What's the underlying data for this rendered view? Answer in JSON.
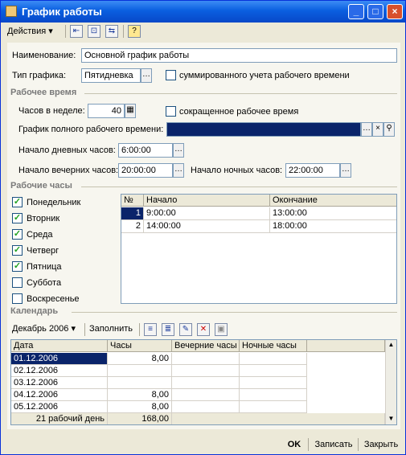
{
  "window": {
    "title": "График работы",
    "min": "_",
    "max": "□",
    "close": "×"
  },
  "toolbar": {
    "actions": "Действия",
    "help": "?"
  },
  "general": {
    "name_label": "Наименование:",
    "name_value": "Основной график работы",
    "type_label": "Тип графика:",
    "type_value": "Пятидневка",
    "summ_label": "суммированного учета рабочего времени"
  },
  "worktime": {
    "section": "Рабочее время",
    "hours_label": "Часов в неделе:",
    "hours_value": "40",
    "short_label": "сокращенное рабочее время",
    "full_label": "График полного рабочего времени:",
    "day_start_label": "Начало дневных часов:",
    "day_start_value": "6:00:00",
    "eve_start_label": "Начало вечерних часов:",
    "eve_start_value": "20:00:00",
    "night_start_label": "Начало ночных часов:",
    "night_start_value": "22:00:00"
  },
  "workhours": {
    "section": "Рабочие часы",
    "days": [
      {
        "label": "Понедельник",
        "checked": true
      },
      {
        "label": "Вторник",
        "checked": true
      },
      {
        "label": "Среда",
        "checked": true
      },
      {
        "label": "Четверг",
        "checked": true
      },
      {
        "label": "Пятница",
        "checked": true
      },
      {
        "label": "Суббота",
        "checked": false
      },
      {
        "label": "Воскресенье",
        "checked": false
      }
    ],
    "columns": [
      "№",
      "Начало",
      "Окончание"
    ],
    "rows": [
      {
        "n": "1",
        "start": "9:00:00",
        "end": "13:00:00"
      },
      {
        "n": "2",
        "start": "14:00:00",
        "end": "18:00:00"
      }
    ]
  },
  "calendar": {
    "section": "Календарь",
    "month": "Декабрь 2006",
    "fill": "Заполнить",
    "columns": [
      "Дата",
      "Часы",
      "Вечерние часы",
      "Ночные часы"
    ],
    "rows": [
      {
        "date": "01.12.2006",
        "hours": "8,00"
      },
      {
        "date": "02.12.2006",
        "hours": ""
      },
      {
        "date": "03.12.2006",
        "hours": ""
      },
      {
        "date": "04.12.2006",
        "hours": "8,00"
      },
      {
        "date": "05.12.2006",
        "hours": "8,00"
      }
    ],
    "footer_days": "21 рабочий день",
    "footer_hours": "168,00"
  },
  "buttons": {
    "ok": "OK",
    "save": "Записать",
    "close": "Закрыть"
  }
}
